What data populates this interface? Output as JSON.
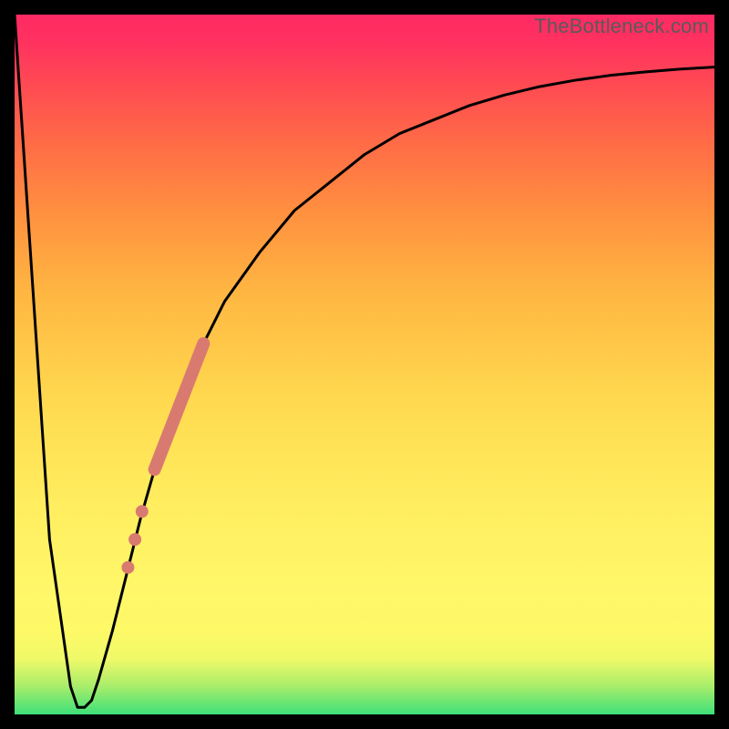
{
  "watermark": "TheBottleneck.com",
  "colors": {
    "frame": "#000000",
    "curve_stroke": "#000000",
    "marker_fill": "#d97a70",
    "gradient_top": "#ff2a64",
    "gradient_bottom": "#3de07a"
  },
  "chart_data": {
    "type": "line",
    "title": "",
    "xlabel": "",
    "ylabel": "",
    "xlim": [
      0,
      100
    ],
    "ylim": [
      0,
      100
    ],
    "grid": false,
    "legend": false,
    "series": [
      {
        "name": "bottleneck-curve",
        "x": [
          0,
          5,
          8,
          9,
          10,
          11,
          12,
          14,
          16,
          18,
          20,
          22,
          25,
          30,
          35,
          40,
          45,
          50,
          55,
          60,
          65,
          70,
          75,
          80,
          85,
          90,
          95,
          100
        ],
        "values": [
          100,
          25,
          4,
          1,
          1,
          2,
          5,
          12,
          20,
          28,
          35,
          41,
          49,
          59,
          66,
          72,
          76,
          80,
          83,
          85,
          87,
          88.5,
          89.7,
          90.6,
          91.3,
          91.8,
          92.2,
          92.5
        ]
      }
    ],
    "markers": {
      "name": "highlighted-segment",
      "type": "line-and-dots",
      "color": "#d97a70",
      "line_segment": {
        "x": [
          20,
          27
        ],
        "values": [
          35,
          53
        ]
      },
      "dots": [
        {
          "x": 18.2,
          "value": 29
        },
        {
          "x": 17.2,
          "value": 25
        },
        {
          "x": 16.2,
          "value": 21
        }
      ]
    }
  }
}
